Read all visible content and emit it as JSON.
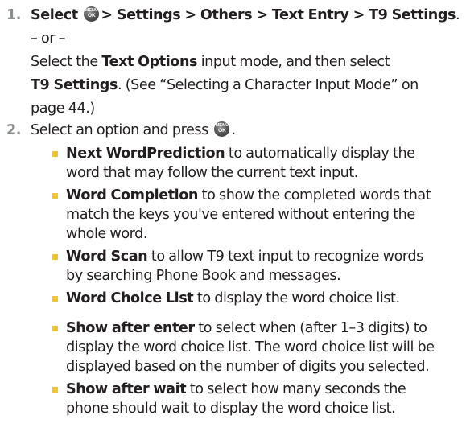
{
  "colors": {
    "text": "#231f20",
    "step_number": "#8a8c8e",
    "bullet": "#f2c230"
  },
  "icons": {
    "menu_ok": {
      "name": "menu-ok-key-icon",
      "line1": "MENU",
      "line2": "OK"
    }
  },
  "step1": {
    "number": "1.",
    "select_word": "Select",
    "path": "> Settings > Others > Text Entry > T9 Settings",
    "path_end": ".",
    "or_text": "– or –",
    "alt_line1_a": "Select the ",
    "alt_text_options": "Text Options",
    "alt_line1_b": " input mode, and then select",
    "alt_t9": "T9 Settings",
    "alt_line2_b": ". (See “Selecting a Character Input Mode” on",
    "alt_line3": "page 44.)"
  },
  "step2": {
    "number": "2.",
    "text_a": "Select an option and press",
    "text_end": "."
  },
  "options": [
    {
      "title": "Next WordPrediction",
      "lines": [
        "to automatically display the",
        "word that may follow the current text input."
      ]
    },
    {
      "title": "Word Completion",
      "lines": [
        "to show the completed words that",
        "match the keys you've entered without entering the",
        "whole word."
      ]
    },
    {
      "title": "Word Scan",
      "lines": [
        "to allow T9 text input to recognize words",
        "by searching Phone Book and messages."
      ]
    },
    {
      "title": "Word Choice List",
      "lines": [
        "to display the word choice list."
      ]
    },
    {
      "title": "Show after enter",
      "lines": [
        "to select when (after 1–3 digits) to",
        "display the word choice list. The word choice list will be",
        "displayed based on the number of digits you selected."
      ]
    },
    {
      "title": "Show after wait",
      "lines": [
        "to select how many seconds the",
        "phone should wait to display the word choice list."
      ]
    }
  ]
}
